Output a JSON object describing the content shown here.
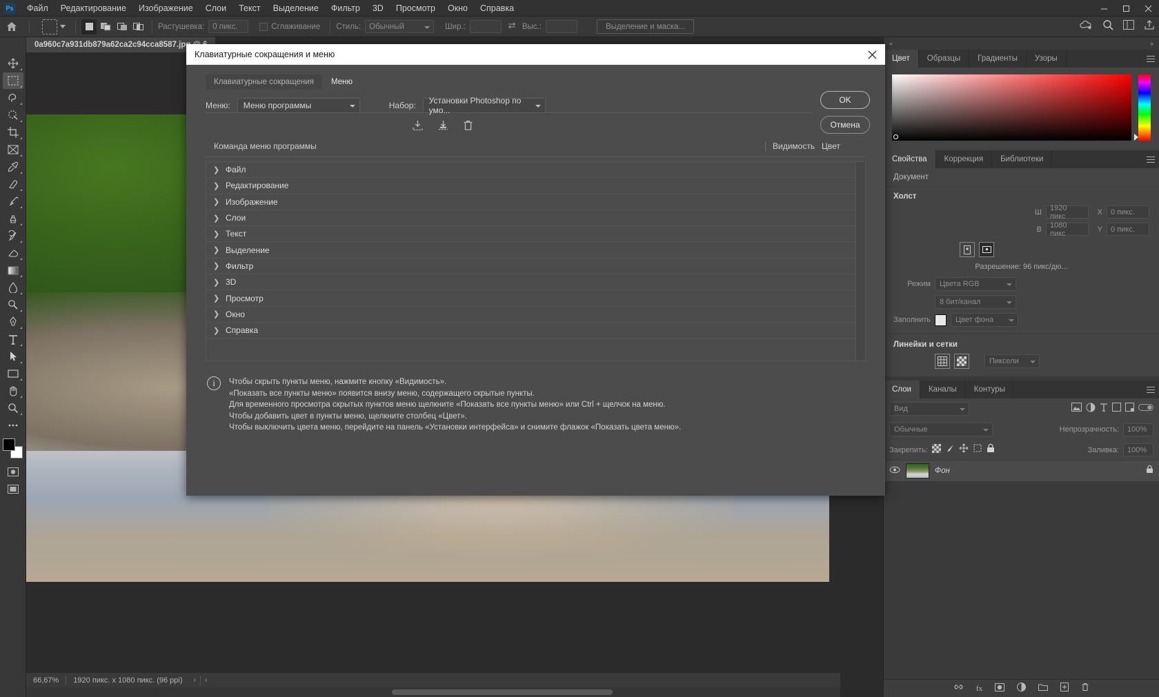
{
  "app": {
    "logo": "ps-logo",
    "menubar": [
      "Файл",
      "Редактирование",
      "Изображение",
      "Слои",
      "Текст",
      "Выделение",
      "Фильтр",
      "3D",
      "Просмотр",
      "Окно",
      "Справка"
    ]
  },
  "options_bar": {
    "home_icon": "home-icon",
    "feather_label": "Растушевка:",
    "feather_value": "0 пикс.",
    "antialias_label": "Сглаживание",
    "style_label": "Стиль:",
    "style_value": "Обычный",
    "width_label": "Шир.:",
    "width_value": "",
    "height_label": "Выс.:",
    "height_value": "",
    "select_mask_button": "Выделение и маска..."
  },
  "document": {
    "tab_title": "0a960c7a931db879a62ca2c94cca8587.jpg @ 6",
    "status_zoom": "66,67%",
    "status_size": "1920 пикс. x 1080 пикс. (96 ppi)"
  },
  "right_panels": {
    "color_tabs": [
      "Цвет",
      "Образцы",
      "Градиенты",
      "Узоры"
    ],
    "color_active_tab": "Цвет",
    "properties_tabs": [
      "Свойства",
      "Коррекция",
      "Библиотеки"
    ],
    "properties_active_tab": "Свойства",
    "properties": {
      "doc_label": "Документ",
      "canvas_title": "Холст",
      "width_label": "Ш",
      "width_value": "1920 пикс",
      "x_label": "X",
      "x_value": "0 пикс.",
      "height_label": "В",
      "height_value": "1080 пикс",
      "y_label": "Y",
      "y_value": "0 пикс.",
      "resolution": "Разрешение: 96 пикс/дю...",
      "mode_label": "Режим",
      "mode_value": "Цвета RGB",
      "depth_value": "8 бит/канал",
      "fill_label": "Заполнить",
      "fill_value": "Цвет фона",
      "rulers_title": "Линейки и сетки",
      "units_value": "Пиксели"
    },
    "layers_tabs": [
      "Слои",
      "Каналы",
      "Контуры"
    ],
    "layers_active_tab": "Слои",
    "layers": {
      "kind_filter": "Вид",
      "blend_mode": "Обычные",
      "opacity_label": "Непрозрачность:",
      "opacity_value": "100%",
      "lock_label": "Закрепить:",
      "fill_label": "Заливка:",
      "fill_value": "100%",
      "rows": [
        {
          "name": "Фон",
          "locked_icon": "lock-icon"
        }
      ]
    }
  },
  "dialog": {
    "title": "Клавиатурные сокращения и меню",
    "close_icon": "close-icon",
    "tabs": [
      {
        "label": "Клавиатурные сокращения",
        "active": false
      },
      {
        "label": "Меню",
        "active": true
      }
    ],
    "menu_label": "Меню:",
    "menu_value": "Меню программы",
    "set_label": "Набор:",
    "set_value": "Установки Photoshop по умо...",
    "icons": [
      "import-set-icon",
      "save-set-icon",
      "delete-set-icon"
    ],
    "columns": {
      "command": "Команда меню программы",
      "visibility": "Видимость",
      "color": "Цвет"
    },
    "rows": [
      "Файл",
      "Редактирование",
      "Изображение",
      "Слои",
      "Текст",
      "Выделение",
      "Фильтр",
      "3D",
      "Просмотр",
      "Окно",
      "Справка"
    ],
    "info_icon": "info-icon",
    "info_lines": [
      "Чтобы скрыть пункты меню, нажмите кнопку «Видимость».",
      "«Показать все пункты меню» появится внизу меню, содержащего скрытые пункты.",
      "Для временного просмотра скрытых пунктов меню щелкните «Показать все пункты меню» или Ctrl + щелчок на меню.",
      "Чтобы добавить цвет в пункты меню, щелкните столбец «Цвет».",
      "Чтобы выключить цвета меню, перейдите на панель «Установки интерфейса» и снимите флажок «Показать цвета меню»."
    ],
    "ok_button": "OK",
    "cancel_button": "Отмена"
  }
}
